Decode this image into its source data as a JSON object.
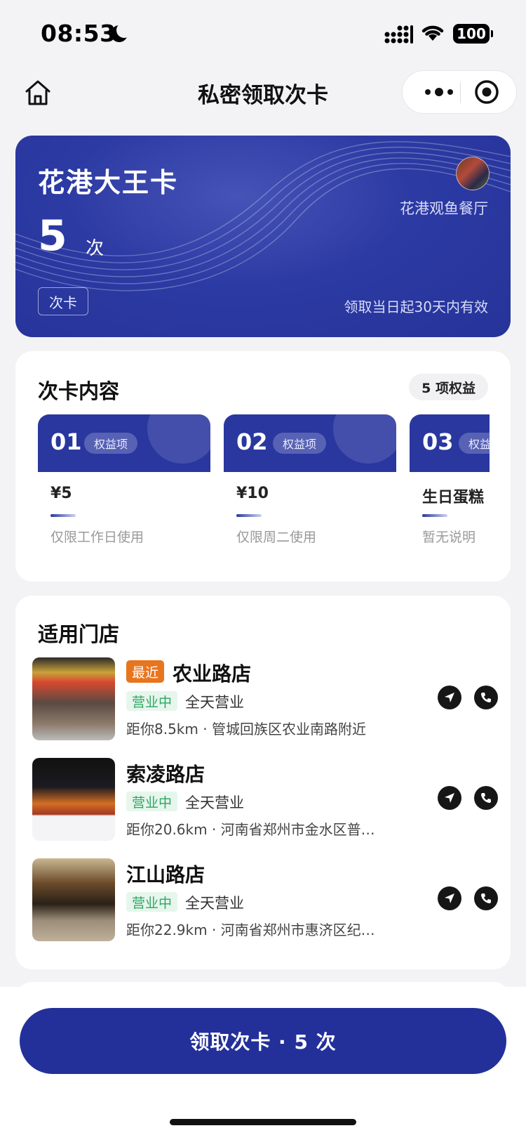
{
  "status_bar": {
    "time": "08:53",
    "battery": "100"
  },
  "nav": {
    "title": "私密领取次卡"
  },
  "hero": {
    "card_name": "花港大王卡",
    "count": "5",
    "count_unit": "次",
    "tag": "次卡",
    "shop_name": "花港观鱼餐厅",
    "validity": "领取当日起30天内有效"
  },
  "benefits": {
    "title": "次卡内容",
    "count_badge": "5 项权益",
    "items": [
      {
        "no": "01",
        "chip": "权益项",
        "value": "¥5",
        "note": "仅限工作日使用"
      },
      {
        "no": "02",
        "chip": "权益项",
        "value": "¥10",
        "note": "仅限周二使用"
      },
      {
        "no": "03",
        "chip": "权益项",
        "value": "生日蛋糕",
        "note": "暂无说明"
      }
    ]
  },
  "stores": {
    "title": "适用门店",
    "items": [
      {
        "recent": "最近",
        "name": "农业路店",
        "status": "营业中",
        "hours": "全天营业",
        "address": "距你8.5km · 管城回族区农业南路附近"
      },
      {
        "name": "索凌路店",
        "status": "营业中",
        "hours": "全天营业",
        "address": "距你20.6km · 河南省郑州市金水区普…"
      },
      {
        "name": "江山路店",
        "status": "营业中",
        "hours": "全天营业",
        "address": "距你22.9km · 河南省郑州市惠济区纪…"
      }
    ]
  },
  "bottom": {
    "claim_label": "领取次卡 · 5 次"
  },
  "colors": {
    "primary": "#23309a",
    "recent": "#e8751e",
    "open": "#2fa565"
  }
}
